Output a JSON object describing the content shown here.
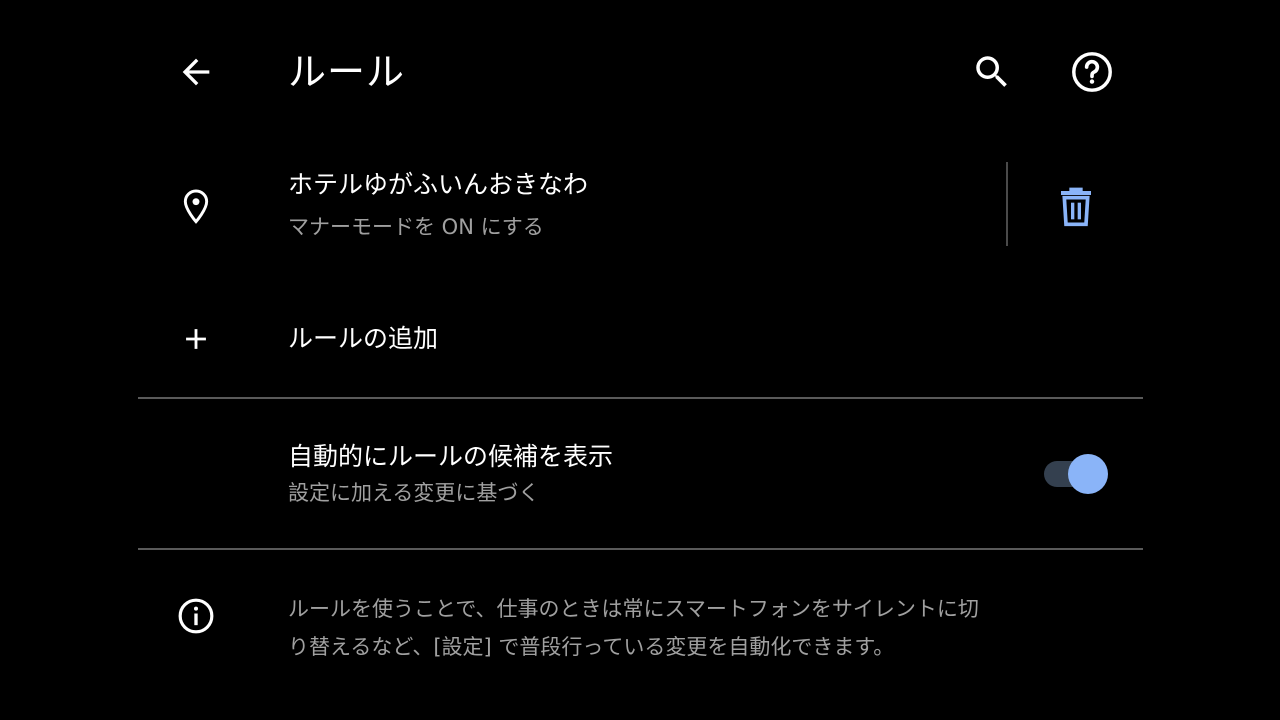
{
  "app_bar": {
    "title": "ルール",
    "back_icon": "arrow-back-icon",
    "search_icon": "search-icon",
    "help_icon": "help-circle-icon"
  },
  "rules": [
    {
      "title": "ホテルゆがふいんおきなわ",
      "subtitle": "マナーモードを ON にする",
      "icon": "location-pin-icon",
      "action_icon": "trash-icon"
    }
  ],
  "add_rule": {
    "label": "ルールの追加",
    "icon": "plus-icon"
  },
  "suggestions": {
    "title": "自動的にルールの候補を表示",
    "subtitle": "設定に加える変更に基づく",
    "enabled": true
  },
  "info": {
    "icon": "info-icon",
    "line1": "ルールを使うことで、仕事のときは常にスマートフォンをサイレントに切",
    "line2": "り替えるなど、[設定] で普段行っている変更を自動化できます。"
  },
  "colors": {
    "background": "#000000",
    "accent": "#8ab4f8",
    "primary_text": "#ffffff",
    "secondary_text": "#a0a0a0",
    "toggle_track": "#34404f"
  }
}
